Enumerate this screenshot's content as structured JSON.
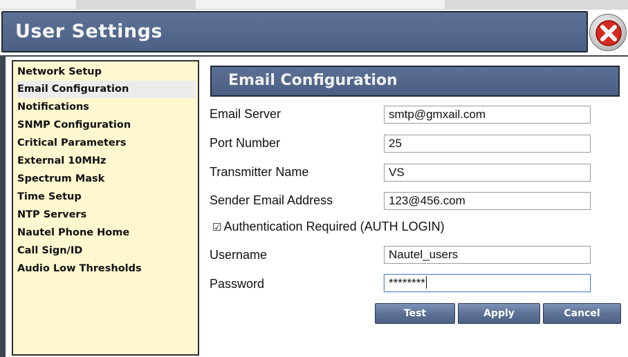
{
  "window": {
    "title": "User Settings"
  },
  "close_icon": "close-icon",
  "sidebar": {
    "items": [
      {
        "label": "Network Setup",
        "active": false
      },
      {
        "label": "Email Configuration",
        "active": true
      },
      {
        "label": "Notifications",
        "active": false
      },
      {
        "label": "SNMP Configuration",
        "active": false
      },
      {
        "label": "Critical Parameters",
        "active": false
      },
      {
        "label": "External 10MHz",
        "active": false
      },
      {
        "label": "Spectrum Mask",
        "active": false
      },
      {
        "label": "Time Setup",
        "active": false
      },
      {
        "label": "NTP Servers",
        "active": false
      },
      {
        "label": "Nautel Phone Home",
        "active": false
      },
      {
        "label": "Call Sign/ID",
        "active": false
      },
      {
        "label": "Audio Low Thresholds",
        "active": false
      }
    ]
  },
  "main": {
    "section_title": "Email Configuration",
    "email_server": {
      "label": "Email Server",
      "value": "smtp@gmxail.com"
    },
    "port_number": {
      "label": "Port Number",
      "value": "25"
    },
    "transmitter_name": {
      "label": "Transmitter Name",
      "value": "VS"
    },
    "sender_email": {
      "label": "Sender Email Address",
      "value": "123@456.com"
    },
    "auth": {
      "checkbox_glyph": "☑",
      "label": "Authentication Required (AUTH LOGIN)",
      "checked": true
    },
    "username": {
      "label": "Username",
      "value": "Nautel_users"
    },
    "password": {
      "label": "Password",
      "value": "********"
    }
  },
  "buttons": {
    "test": "Test",
    "apply": "Apply",
    "cancel": "Cancel"
  },
  "colors": {
    "header_blue": "#4b6084",
    "sidebar_bg": "#fef7cf",
    "frame_dark": "#3e4650",
    "close_red": "#d42a1e"
  }
}
